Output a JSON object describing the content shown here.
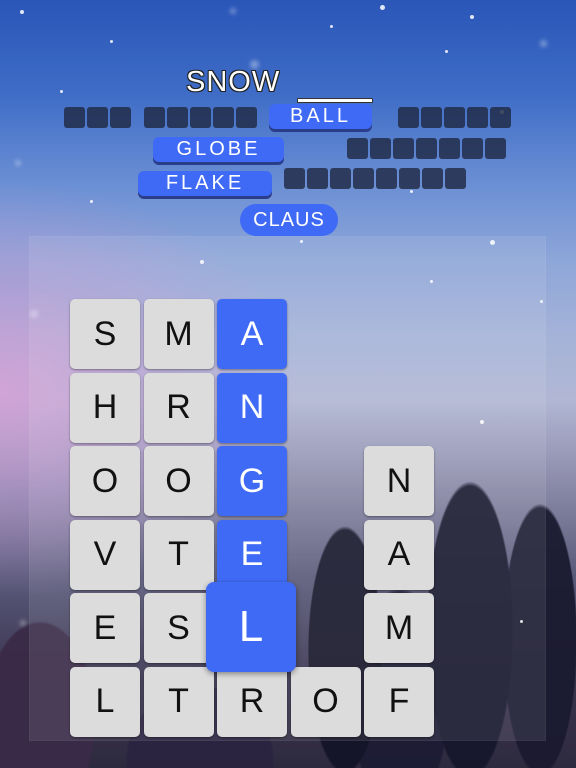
{
  "clue": {
    "prefix": "SNOW",
    "blank": "____"
  },
  "answers": [
    {
      "word": "BALL",
      "state": "found"
    },
    {
      "word": "GLOBE",
      "state": "found"
    },
    {
      "word": "FLAKE",
      "state": "found"
    },
    {
      "word": "CLAUS",
      "state": "hint"
    }
  ],
  "hidden_slots": [
    {
      "letters": 3
    },
    {
      "letters": 5
    },
    {
      "letters": 5
    },
    {
      "letters": 7
    },
    {
      "letters": 8
    }
  ],
  "grid": {
    "columns": 5,
    "tiles": [
      {
        "letter": "S",
        "col": 0,
        "row": 0,
        "state": "normal"
      },
      {
        "letter": "M",
        "col": 1,
        "row": 0,
        "state": "normal"
      },
      {
        "letter": "A",
        "col": 2,
        "row": 0,
        "state": "selected"
      },
      {
        "letter": "H",
        "col": 0,
        "row": 1,
        "state": "normal"
      },
      {
        "letter": "R",
        "col": 1,
        "row": 1,
        "state": "normal"
      },
      {
        "letter": "N",
        "col": 2,
        "row": 1,
        "state": "selected"
      },
      {
        "letter": "O",
        "col": 0,
        "row": 2,
        "state": "normal"
      },
      {
        "letter": "O",
        "col": 1,
        "row": 2,
        "state": "normal"
      },
      {
        "letter": "G",
        "col": 2,
        "row": 2,
        "state": "selected"
      },
      {
        "letter": "N",
        "col": 4,
        "row": 2,
        "state": "normal"
      },
      {
        "letter": "V",
        "col": 0,
        "row": 3,
        "state": "normal"
      },
      {
        "letter": "T",
        "col": 1,
        "row": 3,
        "state": "normal"
      },
      {
        "letter": "E",
        "col": 2,
        "row": 3,
        "state": "selected"
      },
      {
        "letter": "A",
        "col": 4,
        "row": 3,
        "state": "normal"
      },
      {
        "letter": "E",
        "col": 0,
        "row": 4,
        "state": "normal"
      },
      {
        "letter": "S",
        "col": 1,
        "row": 4,
        "state": "normal"
      },
      {
        "letter": "L",
        "col": 2,
        "row": 4,
        "state": "selected-active"
      },
      {
        "letter": "M",
        "col": 4,
        "row": 4,
        "state": "normal"
      },
      {
        "letter": "L",
        "col": 0,
        "row": 5,
        "state": "normal"
      },
      {
        "letter": "T",
        "col": 1,
        "row": 5,
        "state": "normal"
      },
      {
        "letter": "R",
        "col": 2,
        "row": 5,
        "state": "normal"
      },
      {
        "letter": "O",
        "col": 3,
        "row": 5,
        "state": "normal"
      },
      {
        "letter": "F",
        "col": 4,
        "row": 5,
        "state": "normal"
      }
    ]
  },
  "colors": {
    "selected": "#3f6af5",
    "tile": "#dcdcdd",
    "slot": "#202a44"
  }
}
